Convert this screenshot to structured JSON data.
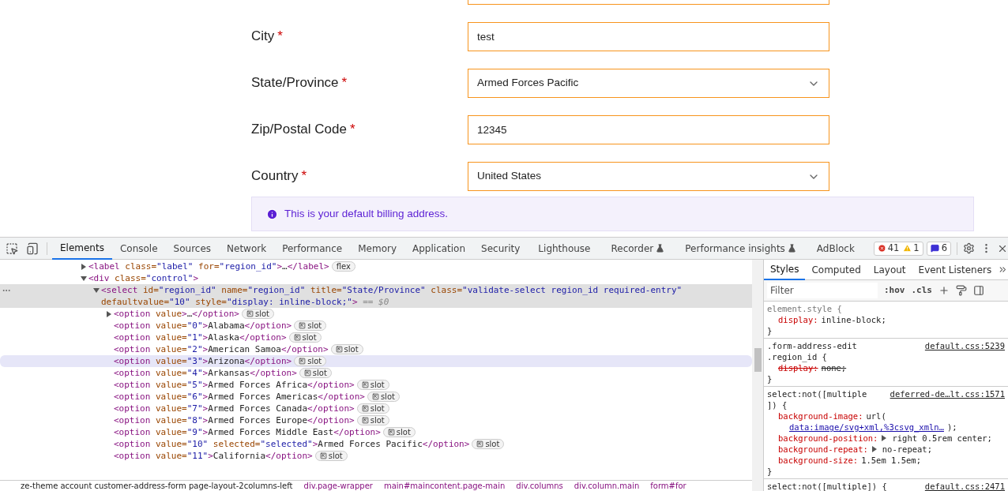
{
  "form": {
    "fields": [
      {
        "label": "City",
        "required": "*",
        "kind": "input",
        "value": "test"
      },
      {
        "label": "State/Province",
        "required": "*",
        "kind": "select",
        "value": "Armed Forces Pacific"
      },
      {
        "label": "Zip/Postal Code",
        "required": "*",
        "kind": "input",
        "value": "12345"
      },
      {
        "label": "Country",
        "required": "*",
        "kind": "select",
        "value": "United States"
      }
    ],
    "notice": "This is your default billing address."
  },
  "devtools": {
    "tabs": [
      {
        "label": "Elements",
        "selected": true,
        "experimental": false
      },
      {
        "label": "Console",
        "selected": false,
        "experimental": false
      },
      {
        "label": "Sources",
        "selected": false,
        "experimental": false
      },
      {
        "label": "Network",
        "selected": false,
        "experimental": false
      },
      {
        "label": "Performance",
        "selected": false,
        "experimental": false
      },
      {
        "label": "Memory",
        "selected": false,
        "experimental": false
      },
      {
        "label": "Application",
        "selected": false,
        "experimental": false
      },
      {
        "label": "Security",
        "selected": false,
        "experimental": false
      },
      {
        "label": "Lighthouse",
        "selected": false,
        "experimental": false
      },
      {
        "label": "Recorder",
        "selected": false,
        "experimental": true
      },
      {
        "label": "Performance insights",
        "selected": false,
        "experimental": true
      },
      {
        "label": "AdBlock",
        "selected": false,
        "experimental": false
      }
    ],
    "counts": {
      "errors": "41",
      "warnings": "1",
      "messages": "6"
    },
    "dom": [
      {
        "expanded": false,
        "badge": "flex",
        "selected": false,
        "hovered": false,
        "parts": [
          {
            "kind": "tag",
            "text": "<label"
          },
          {
            "kind": "attr",
            "text": " class="
          },
          {
            "kind": "val",
            "text": "\"label\""
          },
          {
            "kind": "attr",
            "text": " for="
          },
          {
            "kind": "val",
            "text": "\"region_id\""
          },
          {
            "kind": "tag",
            "text": ">"
          },
          {
            "kind": "text",
            "text": "…"
          },
          {
            "kind": "tag",
            "text": "</label>"
          }
        ]
      },
      {
        "expanded": true,
        "selected": false,
        "hovered": false,
        "parts": [
          {
            "kind": "tag",
            "text": "<div"
          },
          {
            "kind": "attr",
            "text": " class="
          },
          {
            "kind": "val",
            "text": "\"control\""
          },
          {
            "kind": "tag",
            "text": ">"
          }
        ],
        "children": [
          {
            "expanded": true,
            "selected": true,
            "hovered": false,
            "parts": [
              {
                "kind": "tag",
                "text": "<select"
              },
              {
                "kind": "attr",
                "text": " id="
              },
              {
                "kind": "val",
                "text": "\"region_id\""
              },
              {
                "kind": "attr",
                "text": " name="
              },
              {
                "kind": "val",
                "text": "\"region_id\""
              },
              {
                "kind": "attr",
                "text": " title="
              },
              {
                "kind": "val",
                "text": "\"State/Province\""
              },
              {
                "kind": "attr",
                "text": " class="
              },
              {
                "kind": "val",
                "text": "\"validate-select region_id required-entry\""
              },
              {
                "kind": "attr",
                "text": " defaultvalue="
              },
              {
                "kind": "val",
                "text": "\"10\""
              },
              {
                "kind": "attr",
                "text": " style="
              },
              {
                "kind": "val",
                "text": "\"display: inline-block;\""
              },
              {
                "kind": "tag",
                "text": ">"
              },
              {
                "kind": "note",
                "text": " == $0"
              }
            ],
            "children": [
              {
                "expanded": false,
                "badge": "slot",
                "selected": false,
                "hovered": false,
                "parts": [
                  {
                    "kind": "tag",
                    "text": "<option"
                  },
                  {
                    "kind": "attr",
                    "text": " value"
                  },
                  {
                    "kind": "tag",
                    "text": ">"
                  },
                  {
                    "kind": "text",
                    "text": "…"
                  },
                  {
                    "kind": "tag",
                    "text": "</option>"
                  }
                ]
              },
              {
                "badge": "slot",
                "selected": false,
                "hovered": false,
                "parts": [
                  {
                    "kind": "tag",
                    "text": "<option"
                  },
                  {
                    "kind": "attr",
                    "text": " value="
                  },
                  {
                    "kind": "val",
                    "text": "\"0\""
                  },
                  {
                    "kind": "tag",
                    "text": ">"
                  },
                  {
                    "kind": "text",
                    "text": "Alabama"
                  },
                  {
                    "kind": "tag",
                    "text": "</option>"
                  }
                ]
              },
              {
                "badge": "slot",
                "selected": false,
                "hovered": false,
                "parts": [
                  {
                    "kind": "tag",
                    "text": "<option"
                  },
                  {
                    "kind": "attr",
                    "text": " value="
                  },
                  {
                    "kind": "val",
                    "text": "\"1\""
                  },
                  {
                    "kind": "tag",
                    "text": ">"
                  },
                  {
                    "kind": "text",
                    "text": "Alaska"
                  },
                  {
                    "kind": "tag",
                    "text": "</option>"
                  }
                ]
              },
              {
                "badge": "slot",
                "selected": false,
                "hovered": false,
                "parts": [
                  {
                    "kind": "tag",
                    "text": "<option"
                  },
                  {
                    "kind": "attr",
                    "text": " value="
                  },
                  {
                    "kind": "val",
                    "text": "\"2\""
                  },
                  {
                    "kind": "tag",
                    "text": ">"
                  },
                  {
                    "kind": "text",
                    "text": "American Samoa"
                  },
                  {
                    "kind": "tag",
                    "text": "</option>"
                  }
                ]
              },
              {
                "badge": "slot",
                "selected": false,
                "hovered": true,
                "parts": [
                  {
                    "kind": "tag",
                    "text": "<option"
                  },
                  {
                    "kind": "attr",
                    "text": " value="
                  },
                  {
                    "kind": "val",
                    "text": "\"3\""
                  },
                  {
                    "kind": "tag",
                    "text": ">"
                  },
                  {
                    "kind": "text",
                    "text": "Arizona"
                  },
                  {
                    "kind": "tag",
                    "text": "</option>"
                  }
                ]
              },
              {
                "badge": "slot",
                "selected": false,
                "hovered": false,
                "parts": [
                  {
                    "kind": "tag",
                    "text": "<option"
                  },
                  {
                    "kind": "attr",
                    "text": " value="
                  },
                  {
                    "kind": "val",
                    "text": "\"4\""
                  },
                  {
                    "kind": "tag",
                    "text": ">"
                  },
                  {
                    "kind": "text",
                    "text": "Arkansas"
                  },
                  {
                    "kind": "tag",
                    "text": "</option>"
                  }
                ]
              },
              {
                "badge": "slot",
                "selected": false,
                "hovered": false,
                "parts": [
                  {
                    "kind": "tag",
                    "text": "<option"
                  },
                  {
                    "kind": "attr",
                    "text": " value="
                  },
                  {
                    "kind": "val",
                    "text": "\"5\""
                  },
                  {
                    "kind": "tag",
                    "text": ">"
                  },
                  {
                    "kind": "text",
                    "text": "Armed Forces Africa"
                  },
                  {
                    "kind": "tag",
                    "text": "</option>"
                  }
                ]
              },
              {
                "badge": "slot",
                "selected": false,
                "hovered": false,
                "parts": [
                  {
                    "kind": "tag",
                    "text": "<option"
                  },
                  {
                    "kind": "attr",
                    "text": " value="
                  },
                  {
                    "kind": "val",
                    "text": "\"6\""
                  },
                  {
                    "kind": "tag",
                    "text": ">"
                  },
                  {
                    "kind": "text",
                    "text": "Armed Forces Americas"
                  },
                  {
                    "kind": "tag",
                    "text": "</option>"
                  }
                ]
              },
              {
                "badge": "slot",
                "selected": false,
                "hovered": false,
                "parts": [
                  {
                    "kind": "tag",
                    "text": "<option"
                  },
                  {
                    "kind": "attr",
                    "text": " value="
                  },
                  {
                    "kind": "val",
                    "text": "\"7\""
                  },
                  {
                    "kind": "tag",
                    "text": ">"
                  },
                  {
                    "kind": "text",
                    "text": "Armed Forces Canada"
                  },
                  {
                    "kind": "tag",
                    "text": "</option>"
                  }
                ]
              },
              {
                "badge": "slot",
                "selected": false,
                "hovered": false,
                "parts": [
                  {
                    "kind": "tag",
                    "text": "<option"
                  },
                  {
                    "kind": "attr",
                    "text": " value="
                  },
                  {
                    "kind": "val",
                    "text": "\"8\""
                  },
                  {
                    "kind": "tag",
                    "text": ">"
                  },
                  {
                    "kind": "text",
                    "text": "Armed Forces Europe"
                  },
                  {
                    "kind": "tag",
                    "text": "</option>"
                  }
                ]
              },
              {
                "badge": "slot",
                "selected": false,
                "hovered": false,
                "parts": [
                  {
                    "kind": "tag",
                    "text": "<option"
                  },
                  {
                    "kind": "attr",
                    "text": " value="
                  },
                  {
                    "kind": "val",
                    "text": "\"9\""
                  },
                  {
                    "kind": "tag",
                    "text": ">"
                  },
                  {
                    "kind": "text",
                    "text": "Armed Forces Middle East"
                  },
                  {
                    "kind": "tag",
                    "text": "</option>"
                  }
                ]
              },
              {
                "badge": "slot",
                "selected": false,
                "hovered": false,
                "parts": [
                  {
                    "kind": "tag",
                    "text": "<option"
                  },
                  {
                    "kind": "attr",
                    "text": " value="
                  },
                  {
                    "kind": "val",
                    "text": "\"10\""
                  },
                  {
                    "kind": "attr",
                    "text": " selected="
                  },
                  {
                    "kind": "val",
                    "text": "\"selected\""
                  },
                  {
                    "kind": "tag",
                    "text": ">"
                  },
                  {
                    "kind": "text",
                    "text": "Armed Forces Pacific"
                  },
                  {
                    "kind": "tag",
                    "text": "</option>"
                  }
                ]
              },
              {
                "badge": "slot",
                "selected": false,
                "hovered": false,
                "parts": [
                  {
                    "kind": "tag",
                    "text": "<option"
                  },
                  {
                    "kind": "attr",
                    "text": " value="
                  },
                  {
                    "kind": "val",
                    "text": "\"11\""
                  },
                  {
                    "kind": "tag",
                    "text": ">"
                  },
                  {
                    "kind": "text",
                    "text": "California"
                  },
                  {
                    "kind": "tag",
                    "text": "</option>"
                  }
                ]
              }
            ]
          }
        ]
      }
    ],
    "breadcrumbs": [
      {
        "label": "ze-theme account customer-address-form page-layout-2columns-left",
        "kind": "body"
      },
      {
        "label": "div.page-wrapper",
        "kind": "element"
      },
      {
        "label": "main#maincontent.page-main",
        "kind": "element"
      },
      {
        "label": "div.columns",
        "kind": "element"
      },
      {
        "label": "div.column.main",
        "kind": "element"
      },
      {
        "label": "form#for",
        "kind": "element"
      }
    ],
    "side_tabs": [
      {
        "label": "Styles",
        "selected": true
      },
      {
        "label": "Computed",
        "selected": false
      },
      {
        "label": "Layout",
        "selected": false
      },
      {
        "label": "Event Listeners",
        "selected": false
      }
    ],
    "filter": {
      "placeholder": "Filter"
    },
    "style_buttons": [
      ":hov",
      ".cls"
    ],
    "rules": [
      {
        "selector": [
          "element.style {"
        ],
        "inline": true,
        "close": "}",
        "decls": [
          {
            "property": "display:",
            "value": "inline-block;",
            "struck": false
          }
        ]
      },
      {
        "selector": [
          ".form-address-edit",
          ".region_id {"
        ],
        "inline": false,
        "source": "default.css:5239",
        "close": "}",
        "decls": [
          {
            "property": "display:",
            "value": "none;",
            "struck": true
          }
        ]
      },
      {
        "selector": [
          "select:not([multiple",
          "]) {"
        ],
        "inline": false,
        "source": "deferred-de…lt.css:1571",
        "close": "}",
        "decls": [
          {
            "property": "background-image:",
            "value": "url(",
            "link": "data:image/svg+xml,%3csvg_xmln…",
            "after": ");",
            "struck": false
          },
          {
            "property": "background-position:",
            "expandable": true,
            "value": "right 0.5rem center;",
            "struck": false
          },
          {
            "property": "background-repeat:",
            "expandable": true,
            "value": "no-repeat;",
            "struck": false
          },
          {
            "property": "background-size:",
            "value": "1.5em 1.5em;",
            "struck": false
          }
        ]
      },
      {
        "selector": [
          "select:not([multiple]) {"
        ],
        "inline": false,
        "source": "default.css:2471"
      }
    ]
  }
}
